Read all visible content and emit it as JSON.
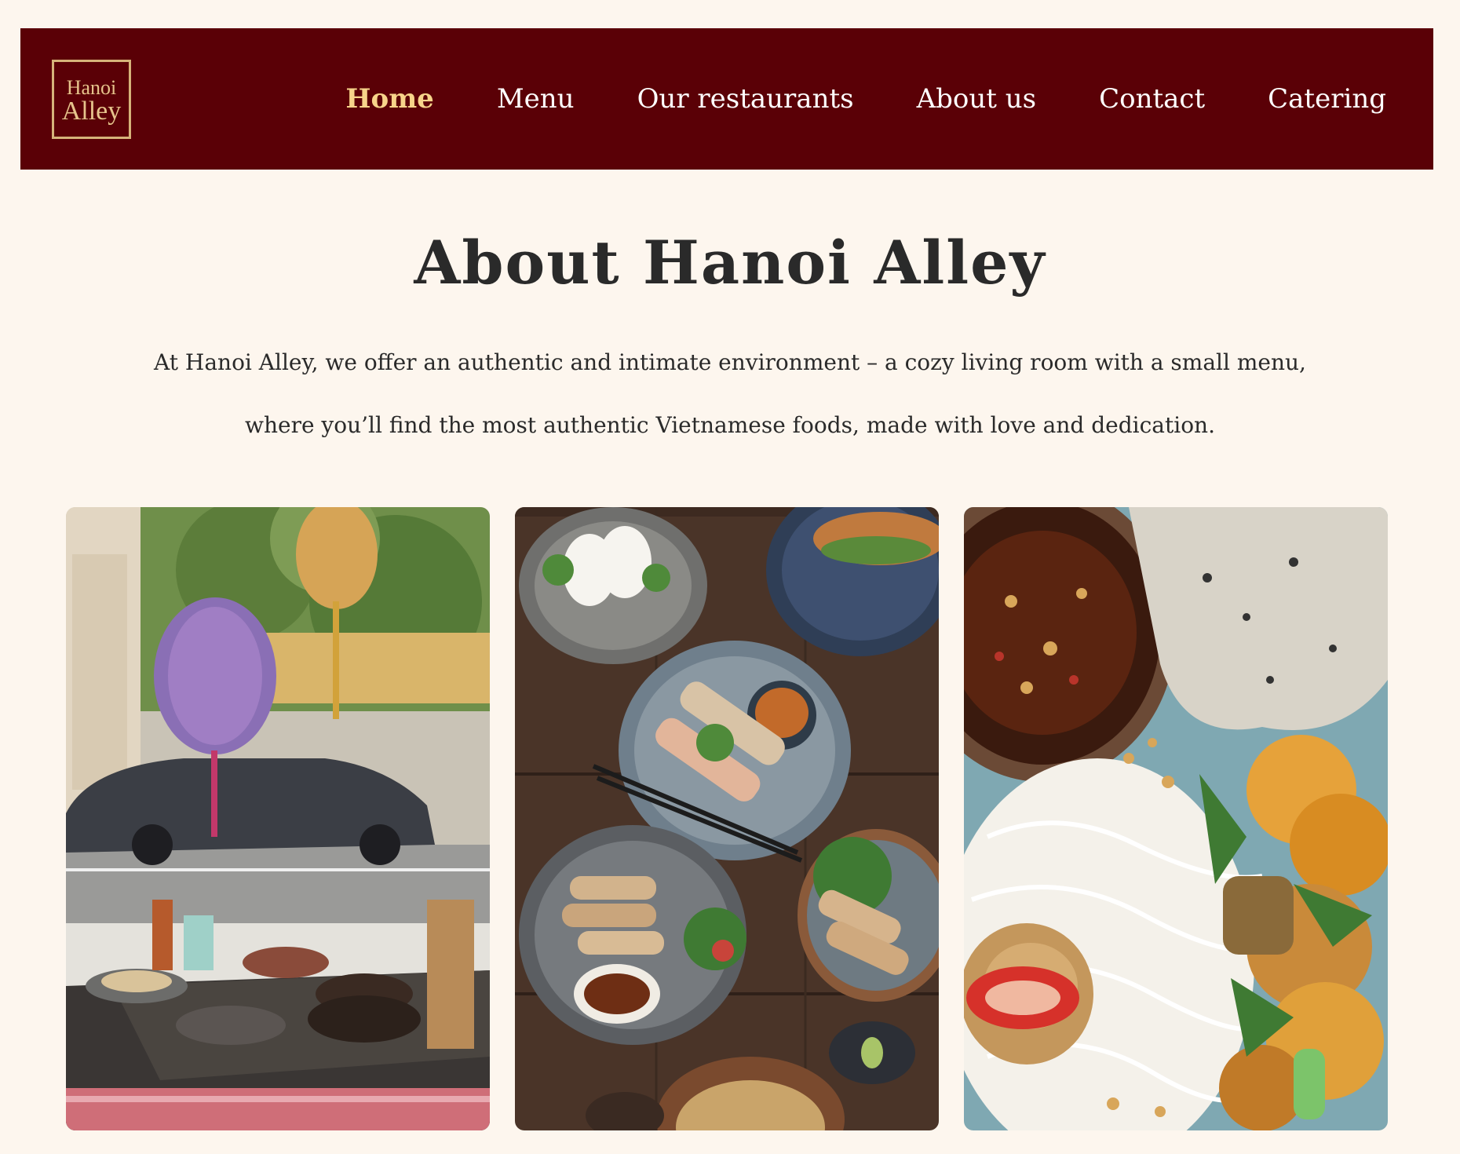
{
  "nav": {
    "logo": {
      "line1": "Hanoi",
      "line2": "Alley"
    },
    "links": [
      {
        "label": "Home",
        "active": true
      },
      {
        "label": "Menu"
      },
      {
        "label": "Our restaurants"
      },
      {
        "label": "About us"
      },
      {
        "label": "Contact"
      },
      {
        "label": "Catering"
      }
    ]
  },
  "about": {
    "title": "About Hanoi Alley",
    "line1": "At Hanoi Alley, we offer an authentic and intimate environment – a cozy living room with a small menu,",
    "line2": "where you’ll find the most authentic Vietnamese foods, made with love and dedication."
  },
  "colors": {
    "page_background": "#fdf6ee",
    "navbar_background": "#5a0006",
    "active_link": "#f7d48a",
    "logo_gold": "#d6b37a",
    "text_dark": "#2a2a2a"
  }
}
